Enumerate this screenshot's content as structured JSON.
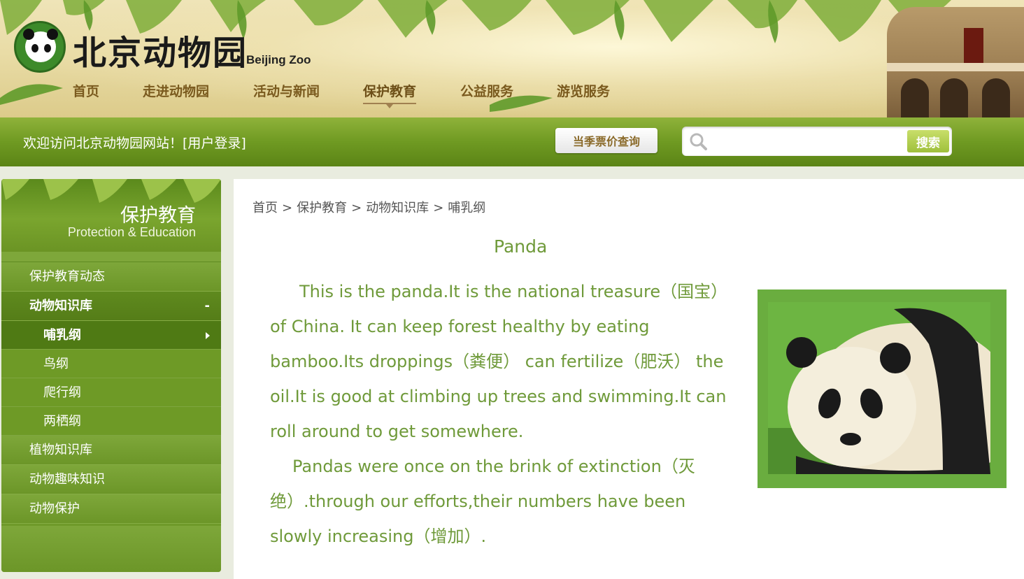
{
  "header": {
    "logo_cn": "北京动物园",
    "logo_en": "Beijing Zoo",
    "nav": [
      "首页",
      "走进动物园",
      "活动与新闻",
      "保护教育",
      "公益服务",
      "游览服务"
    ],
    "nav_active": "保护教育"
  },
  "bar": {
    "welcome": "欢迎访问北京动物园网站！",
    "login": "[用户登录]",
    "ticket_button": "当季票价查询",
    "search_placeholder": "",
    "search_button": "搜索"
  },
  "sidebar": {
    "title_cn": "保护教育",
    "title_en": "Protection & Education",
    "items": [
      {
        "label": "保护教育动态"
      },
      {
        "label": "动物知识库",
        "toggle": "-"
      },
      {
        "label": "植物知识库"
      },
      {
        "label": "动物趣味知识"
      },
      {
        "label": "动物保护"
      }
    ],
    "subitems": [
      "哺乳纲",
      "鸟纲",
      "爬行纲",
      "两栖纲"
    ],
    "active_subitem": "哺乳纲"
  },
  "breadcrumb": [
    "首页",
    "保护教育",
    "动物知识库",
    "哺乳纲"
  ],
  "article": {
    "title": "Panda",
    "paragraphs": [
      "This is the panda.It is the national treasure（国宝） of China.  It can keep forest healthy by eating bamboo.Its droppings（粪便） can fertilize（肥沃） the oil.It is good at climbing up trees and swimming.It can roll around to get somewhere.",
      "Pandas were once on the brink of extinction（灭绝）.through our efforts,their numbers have been slowly increasing（增加）."
    ],
    "image_subject": "panda"
  },
  "colors": {
    "green_bar": "#6f9a22",
    "sidebar": "#6f9a2a",
    "article_text": "#6f9a3a",
    "photo_frame": "#6aad3f"
  }
}
